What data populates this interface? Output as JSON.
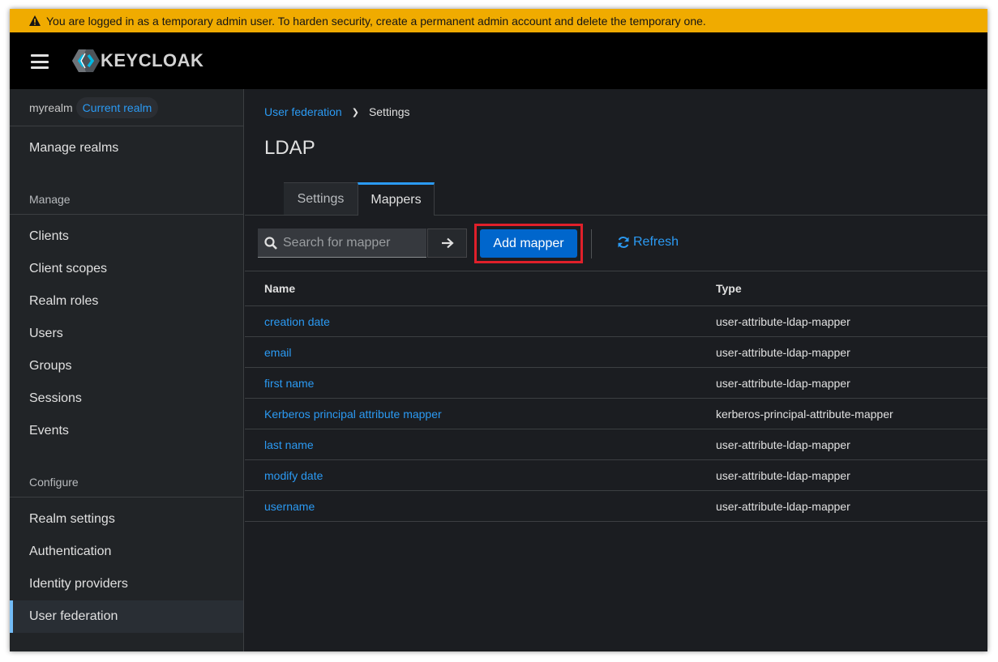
{
  "banner": {
    "text": "You are logged in as a temporary admin user. To harden security, create a permanent admin account and delete the temporary one."
  },
  "masthead": {
    "logo_text": "KEYCLOAK"
  },
  "sidebar": {
    "realm_name": "myrealm",
    "realm_badge": "Current realm",
    "manage_realms": "Manage realms",
    "section_manage": "Manage",
    "manage_items": [
      "Clients",
      "Client scopes",
      "Realm roles",
      "Users",
      "Groups",
      "Sessions",
      "Events"
    ],
    "section_configure": "Configure",
    "configure_items": [
      "Realm settings",
      "Authentication",
      "Identity providers",
      "User federation"
    ],
    "active_item": "User federation"
  },
  "breadcrumb": {
    "parent": "User federation",
    "current": "Settings"
  },
  "page": {
    "title": "LDAP"
  },
  "tabs": {
    "settings": "Settings",
    "mappers": "Mappers",
    "active": "Mappers"
  },
  "toolbar": {
    "search_placeholder": "Search for mapper",
    "add_label": "Add mapper",
    "refresh_label": "Refresh"
  },
  "table": {
    "headers": {
      "name": "Name",
      "type": "Type"
    },
    "rows": [
      {
        "name": "creation date",
        "type": "user-attribute-ldap-mapper"
      },
      {
        "name": "email",
        "type": "user-attribute-ldap-mapper"
      },
      {
        "name": "first name",
        "type": "user-attribute-ldap-mapper"
      },
      {
        "name": "Kerberos principal attribute mapper",
        "type": "kerberos-principal-attribute-mapper"
      },
      {
        "name": "last name",
        "type": "user-attribute-ldap-mapper"
      },
      {
        "name": "modify date",
        "type": "user-attribute-ldap-mapper"
      },
      {
        "name": "username",
        "type": "user-attribute-ldap-mapper"
      }
    ]
  },
  "colors": {
    "banner": "#f0ab00",
    "link": "#2b9af3",
    "primary_button": "#0066cc",
    "highlight": "#e0202a"
  }
}
